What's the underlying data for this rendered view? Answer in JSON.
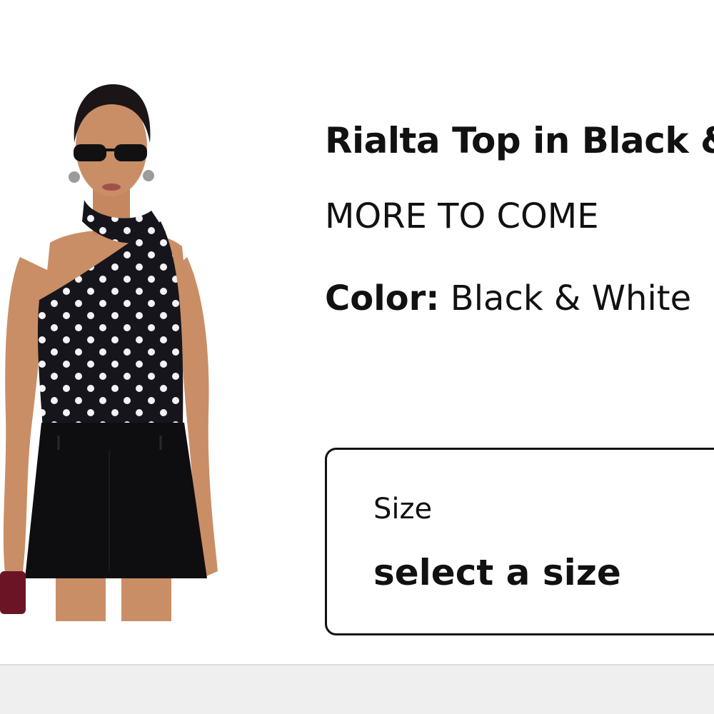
{
  "product": {
    "title": "Rialta Top in Black & White",
    "brand": "MORE TO COME",
    "color_label": "Color:",
    "color_value": "Black & White",
    "image_alt": "Model wearing polka dot one-shoulder scarf top with black mini skirt"
  },
  "size_selector": {
    "label": "Size",
    "value": "select a size"
  },
  "colors": {
    "text": "#111111",
    "background": "#ffffff",
    "bottom_bar": "#efefef",
    "garment": "#17151c",
    "dots": "#f4f2f6"
  }
}
